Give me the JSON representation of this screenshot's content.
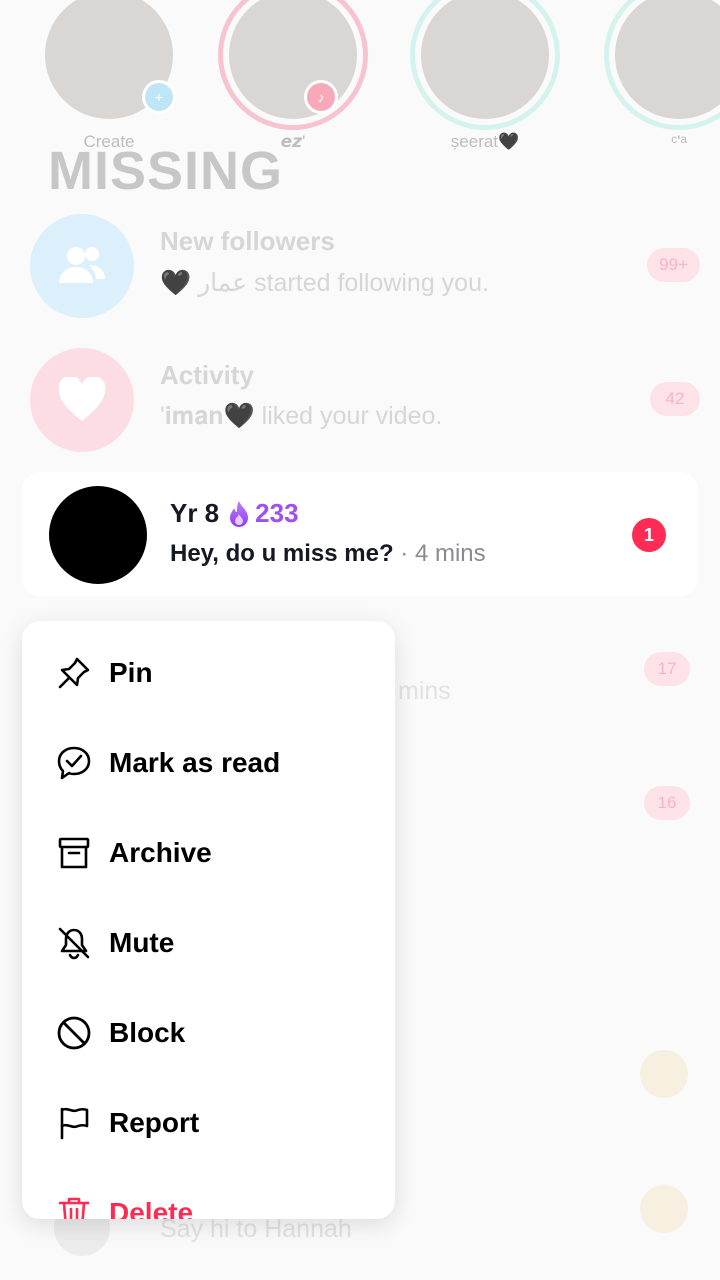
{
  "background": {
    "stories": [
      {
        "name": "Create",
        "ring": "",
        "tag": ""
      },
      {
        "name": "𝙚𝙯'",
        "ring": "#fe2c55",
        "tag": "♪"
      },
      {
        "name": "ṣeerat🖤",
        "ring": "#5fe0d0",
        "tag": ""
      },
      {
        "name": "ᶜ'ᵃ",
        "ring": "#5fe0d0",
        "tag": ""
      }
    ],
    "title": "MISSING",
    "rows": [
      {
        "title": "New followers",
        "subtitle": "🖤 عمار started following you.",
        "badge": "99+"
      },
      {
        "title": "Activity",
        "subtitle": "'𝐢𝐦𝐚𝐧🖤 liked your video.",
        "badge": "42"
      }
    ],
    "hidden_badges": [
      "17",
      "16"
    ],
    "ghost_texts": [
      "mins",
      "Say hi to Hannah"
    ]
  },
  "chat": {
    "name": "Yr 8",
    "streak_icon": "flame-icon",
    "streak_count": "233",
    "message": "Hey, do u miss me?",
    "separator": "·",
    "time": "4 mins",
    "unread": "1",
    "colors": {
      "streak": "#a04ff0",
      "badge": "#fe2c55"
    }
  },
  "menu": {
    "items": [
      {
        "label": "Pin",
        "icon": "pin-icon"
      },
      {
        "label": "Mark as read",
        "icon": "mark-read-icon"
      },
      {
        "label": "Archive",
        "icon": "archive-icon"
      },
      {
        "label": "Mute",
        "icon": "mute-bell-icon"
      },
      {
        "label": "Block",
        "icon": "block-icon"
      },
      {
        "label": "Report",
        "icon": "flag-icon"
      },
      {
        "label": "Delete",
        "icon": "trash-icon",
        "color": "#fe2c55"
      }
    ]
  }
}
